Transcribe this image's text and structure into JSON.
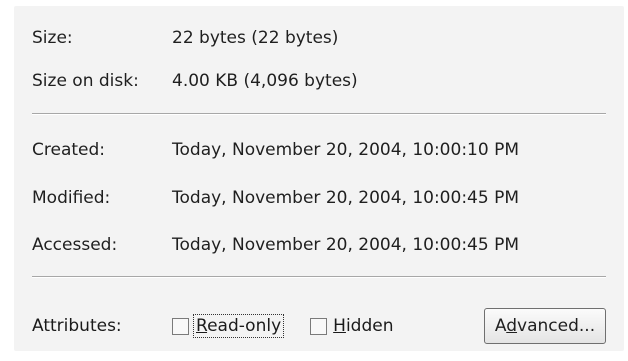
{
  "info": {
    "size_label": "Size:",
    "size_value": "22 bytes (22 bytes)",
    "size_on_disk_label": "Size on disk:",
    "size_on_disk_value": "4.00 KB (4,096 bytes)"
  },
  "dates": {
    "created_label": "Created:",
    "created_value": "Today, November 20, 2004, 10:00:10 PM",
    "modified_label": "Modified:",
    "modified_value": "Today, November 20, 2004, 10:00:45 PM",
    "accessed_label": "Accessed:",
    "accessed_value": "Today, November 20, 2004, 10:00:45 PM"
  },
  "attributes": {
    "label": "Attributes:",
    "readonly_prefix": "",
    "readonly_mnemonic": "R",
    "readonly_rest": "ead-only",
    "readonly_checked": false,
    "hidden_mnemonic": "H",
    "hidden_rest": "idden",
    "hidden_checked": false,
    "advanced_prefix": "A",
    "advanced_mnemonic": "d",
    "advanced_rest": "vanced..."
  }
}
